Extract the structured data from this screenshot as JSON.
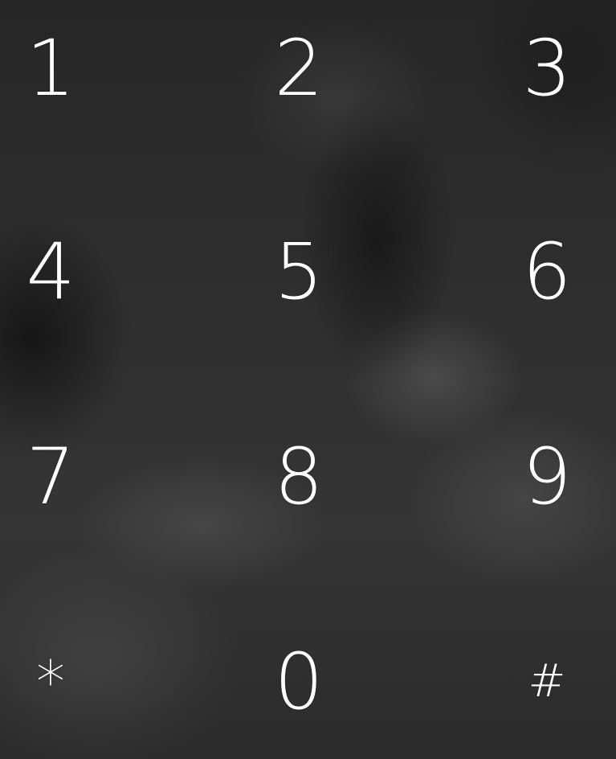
{
  "keypad": {
    "keys": [
      {
        "label": "1"
      },
      {
        "label": "2"
      },
      {
        "label": "3"
      },
      {
        "label": "4"
      },
      {
        "label": "5"
      },
      {
        "label": "6"
      },
      {
        "label": "7"
      },
      {
        "label": "8"
      },
      {
        "label": "9"
      },
      {
        "label": "*"
      },
      {
        "label": "0"
      },
      {
        "label": "#"
      }
    ]
  },
  "colors": {
    "key_text": "#ffffff",
    "background": "#2e2e2e"
  }
}
